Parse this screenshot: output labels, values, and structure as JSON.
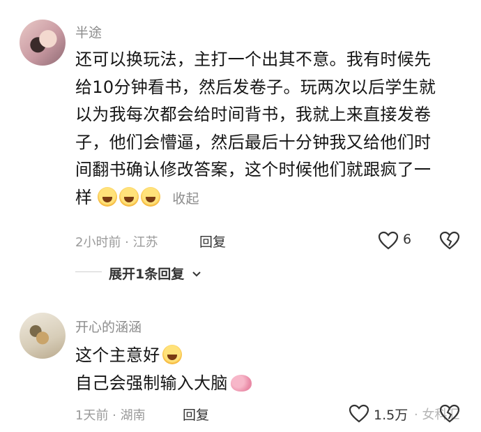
{
  "comments": [
    {
      "username": "半途",
      "lines": [
        "还可以换玩法，主打一个出其不意。我有时候先",
        "给10分钟看书，然后发卷子。玩两次以后学生就",
        "以为我每次都会给时间背书，我就上来直接发卷",
        "子，他们会懵逼，然后最后十分钟我又给他们时",
        "间翻书确认修改答案，这个时候他们就跟疯了一",
        "样"
      ],
      "emoji_names": [
        "laughing-tears-emoji",
        "laughing-tears-emoji",
        "laughing-tears-emoji"
      ],
      "collapse": "收起",
      "meta": "2小时前 · 江苏",
      "reply": "回复",
      "likes": "6",
      "expand_replies": "展开1条回复"
    },
    {
      "username": "开心的涵涵",
      "lines": [
        "这个主意好",
        "自己会强制输入大脑"
      ],
      "meta": "1天前 · 湖南",
      "reply": "回复",
      "likes": "1.5万"
    }
  ],
  "watermark": "· 女科汇"
}
